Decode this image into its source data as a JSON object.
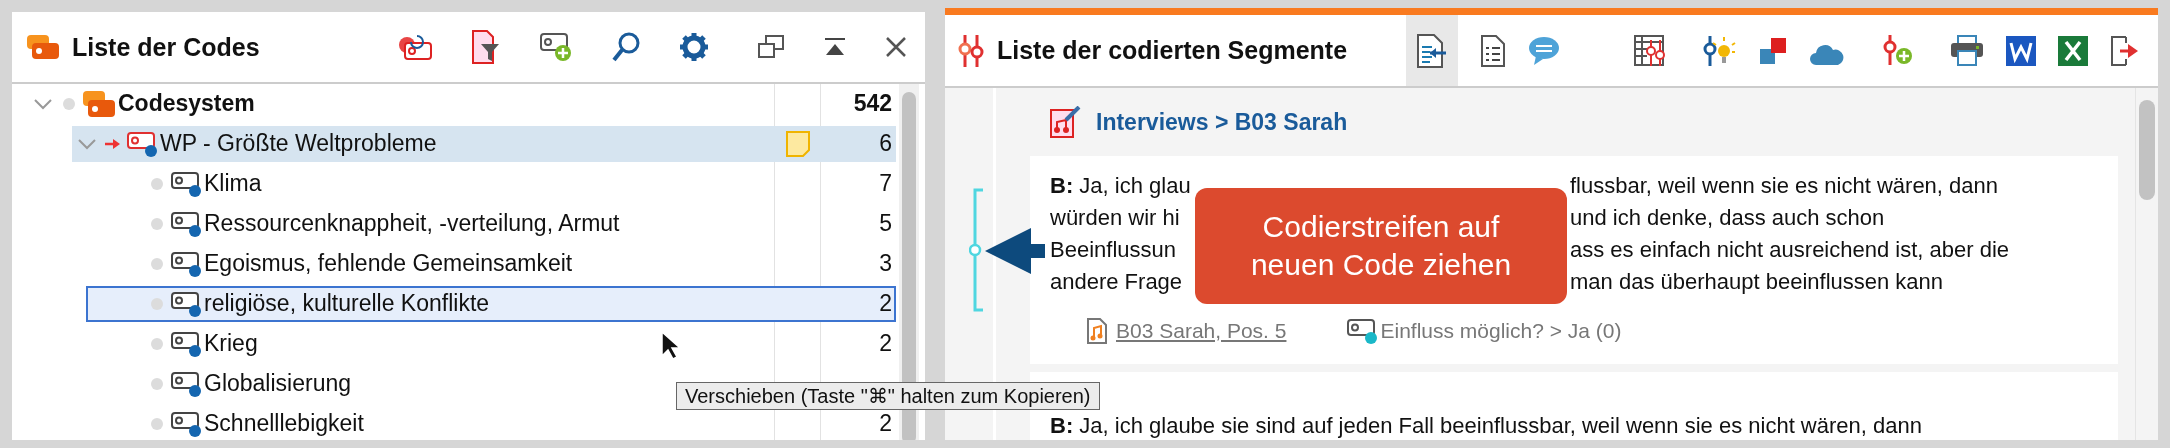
{
  "codes_panel": {
    "title": "Liste der Codes",
    "tree": [
      {
        "label": "Codesystem",
        "count": "542",
        "kind": "root",
        "expanded": true,
        "selected": false,
        "drop_target": false,
        "memo": false,
        "children": [
          {
            "label": "WP - Größte Weltprobleme",
            "count": "6",
            "kind": "parent",
            "expanded": true,
            "selected": true,
            "drop_target": false,
            "memo": true,
            "children": [
              {
                "label": "Klima",
                "count": "7",
                "kind": "code",
                "selected": false,
                "drop_target": false,
                "memo": false
              },
              {
                "label": "Ressourcenknappheit, -verteilung, Armut",
                "count": "5",
                "kind": "code",
                "selected": false,
                "drop_target": false,
                "memo": false
              },
              {
                "label": "Egoismus, fehlende Gemeinsamkeit",
                "count": "3",
                "kind": "code",
                "selected": false,
                "drop_target": false,
                "memo": false
              },
              {
                "label": "religiöse, kulturelle Konflikte",
                "count": "2",
                "kind": "code",
                "selected": false,
                "drop_target": true,
                "memo": false
              },
              {
                "label": "Krieg",
                "count": "2",
                "kind": "code",
                "selected": false,
                "drop_target": false,
                "memo": false
              },
              {
                "label": "Globalisierung",
                "kind": "code",
                "selected": false,
                "drop_target": false,
                "memo": false
              },
              {
                "label": "Schnelllebigkeit",
                "count": "2",
                "kind": "code",
                "selected": false,
                "drop_target": false,
                "memo": false
              }
            ]
          }
        ]
      }
    ],
    "tooltip": "Verschieben (Taste \"⌘\" halten zum Kopieren)"
  },
  "segments_panel": {
    "title": "Liste der codierten Segmente",
    "document": "Interviews > B03 Sarah",
    "callout": [
      "Codierstreifen auf",
      "neuen Code ziehen"
    ],
    "segments": [
      {
        "lines": [
          {
            "left": "**B:** Ja, ich glau",
            "right": "flussbar, weil wenn sie es nicht wären, dann"
          },
          {
            "left": "würden wir hi",
            "right": "und ich denke, dass auch schon"
          },
          {
            "left": "Beeinflussun",
            "right": "ass es einfach nicht ausreichend ist, aber die"
          },
          {
            "left": "andere Frage",
            "right": "man das überhaupt beeinflussen kann"
          }
        ],
        "source": "B03 Sarah, Pos. 5",
        "code": "Einfluss möglich? > Ja (0)"
      }
    ],
    "next_segment": "**B:** Ja, ich glaube sie sind auf jeden Fall beeinflussbar, weil wenn sie es nicht wären, dann"
  }
}
